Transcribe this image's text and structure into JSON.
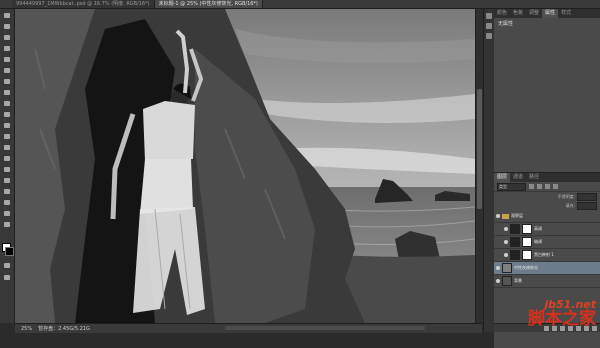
{
  "app": {
    "tabs": [
      {
        "label": "994449997_1MWkbcat..psd @ 16.7% (明度, RGB/16*)",
        "active": false
      },
      {
        "label": "未标题-1 @ 25% (中性灰修饰光, RGB/16*)",
        "active": true
      }
    ]
  },
  "status": {
    "zoom": "25%",
    "doc": "暂存盘：2.45G/5.21G"
  },
  "panels": {
    "tabs": [
      "颜色",
      "色板",
      "调整",
      "属性",
      "样式"
    ],
    "active_tab": "属性",
    "properties_text": "无属性",
    "layers_tabs": [
      "图层",
      "通道",
      "路径"
    ],
    "kind_filter": "类型",
    "opacity_label": "不透明度:",
    "fill_label": "填充:",
    "layers": [
      {
        "name": "观察层",
        "type": "group",
        "selected": false
      },
      {
        "name": "高调",
        "type": "adjust",
        "selected": false
      },
      {
        "name": "暗调",
        "type": "adjust",
        "selected": false
      },
      {
        "name": "黑白映射 1",
        "type": "adjust",
        "selected": false
      },
      {
        "name": "中性灰修饰光",
        "type": "pixel",
        "selected": true
      },
      {
        "name": "背景",
        "type": "pixel",
        "selected": false
      }
    ]
  },
  "watermark": {
    "url": "jb51.net",
    "name": "脚本之家"
  },
  "colors": {
    "accent_red": "#d8301a",
    "selected_layer": "#6c7c8c"
  }
}
